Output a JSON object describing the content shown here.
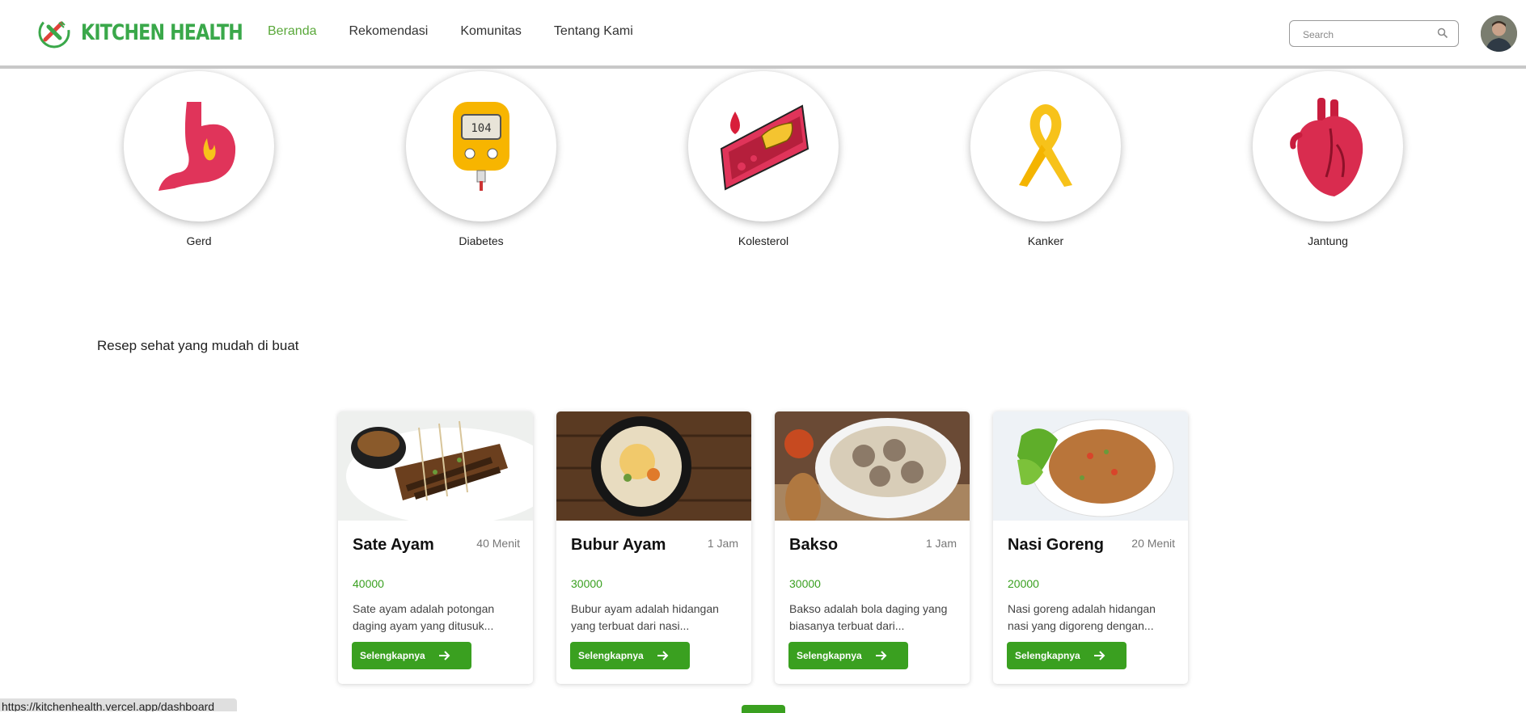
{
  "header": {
    "brand": "KITCHEN HEALTH",
    "nav": [
      {
        "label": "Beranda",
        "active": true
      },
      {
        "label": "Rekomendasi",
        "active": false
      },
      {
        "label": "Komunitas",
        "active": false
      },
      {
        "label": "Tentang Kami",
        "active": false
      }
    ],
    "search": {
      "placeholder": "Search",
      "value": ""
    }
  },
  "categories": [
    {
      "label": "Gerd",
      "icon": "stomach-icon"
    },
    {
      "label": "Diabetes",
      "icon": "glucose-meter-icon"
    },
    {
      "label": "Kolesterol",
      "icon": "artery-cholesterol-icon"
    },
    {
      "label": "Kanker",
      "icon": "cancer-ribbon-icon"
    },
    {
      "label": "Jantung",
      "icon": "heart-icon"
    }
  ],
  "section": {
    "title": "Resep sehat yang mudah di buat"
  },
  "recipes": [
    {
      "title": "Sate Ayam",
      "time": "40 Menit",
      "price": "40000",
      "desc": "Sate ayam adalah potongan daging ayam yang ditusuk...",
      "button": "Selengkapnya"
    },
    {
      "title": "Bubur Ayam",
      "time": "1 Jam",
      "price": "30000",
      "desc": "Bubur ayam adalah hidangan yang terbuat dari nasi...",
      "button": "Selengkapnya"
    },
    {
      "title": "Bakso",
      "time": "1 Jam",
      "price": "30000",
      "desc": "Bakso adalah bola daging yang biasanya terbuat dari...",
      "button": "Selengkapnya"
    },
    {
      "title": "Nasi Goreng",
      "time": "20 Menit",
      "price": "20000",
      "desc": "Nasi goreng adalah hidangan nasi yang digoreng dengan...",
      "button": "Selengkapnya"
    }
  ],
  "status_url": "https://kitchenhealth.vercel.app/dashboard",
  "colors": {
    "brand": "#3aa84a",
    "accent": "#3aa020",
    "nav_active": "#5aa83a"
  }
}
